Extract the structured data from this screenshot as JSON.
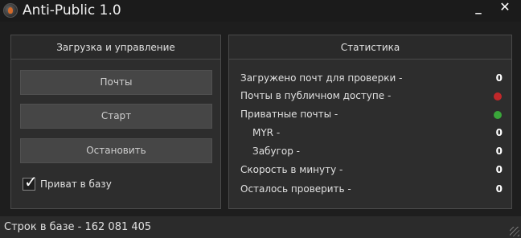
{
  "window": {
    "title": "Anti-Public 1.0",
    "icon": "app-logo-icon",
    "minimize_label": "_",
    "close_label": "✕"
  },
  "left_panel": {
    "header": "Загрузка и управление",
    "buttons": {
      "mails": "Почты",
      "start": "Старт",
      "stop": "Остановить"
    },
    "checkbox": {
      "label": "Приват в базу",
      "checked": true
    }
  },
  "right_panel": {
    "header": "Статистика",
    "rows": [
      {
        "label": "Загружено почт для проверки -",
        "value": "0"
      },
      {
        "label": "Почты в публичном доступе -",
        "indicator": "red",
        "indicator_color": "#c0282a"
      },
      {
        "label": "Приватные почты -",
        "indicator": "green",
        "indicator_color": "#3aa63a"
      },
      {
        "label": "MYR -",
        "value": "0"
      },
      {
        "label": "Забугор -",
        "value": "0"
      },
      {
        "label": "Скорость в минуту -",
        "value": "0"
      },
      {
        "label": "Осталось проверить -",
        "value": "0"
      }
    ]
  },
  "status_bar": {
    "text": "Строк в базе - 162 081 405"
  },
  "colors": {
    "background": "#1e1e1e",
    "panel": "#2d2d2d",
    "button": "#464646",
    "text": "#e0e0e0"
  }
}
